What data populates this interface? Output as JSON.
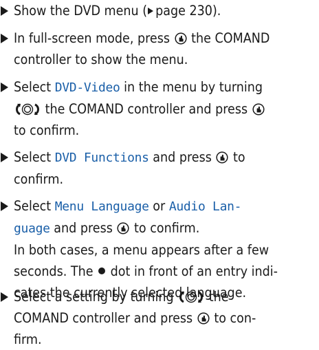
{
  "steps": [
    {
      "lines": [
        "Show the DVD menu (",
        "page 230)."
      ]
    },
    {
      "lines": [
        "In full-screen mode, press",
        "the COMAND",
        "controller to show the menu."
      ]
    },
    {
      "lines": [
        "Select",
        "DVD-Video",
        "in the menu by turning",
        "the COMAND controller and press",
        "to confirm."
      ]
    },
    {
      "lines": [
        "Select",
        "DVD Functions",
        "and press",
        "to",
        "confirm."
      ]
    },
    {
      "lines": [
        "Select",
        "Menu Language",
        "or",
        "Audio Lan-",
        "guage",
        "and press",
        "to confirm.",
        "In both cases, a menu appears after a few",
        "seconds. The",
        "dot in front of an entry indi-",
        "cates the currently selected language."
      ]
    },
    {
      "lines": [
        "Select a setting by turning",
        "the",
        "COMAND controller and press",
        "to con-",
        "firm."
      ]
    }
  ],
  "icons": {
    "bullet": "triangle-bullet-icon",
    "page_ref": "page-reference-triangle-icon",
    "press": "controller-press-icon",
    "turn": "controller-turn-icon",
    "dot": "selected-dot-icon"
  }
}
